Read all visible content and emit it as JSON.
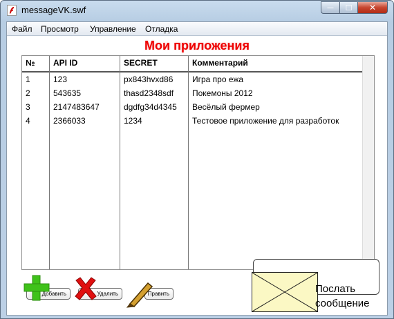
{
  "window": {
    "title": "messageVK.swf",
    "controls": {
      "minimize": "—",
      "maximize": "☐",
      "close": "✕"
    }
  },
  "menu": {
    "items": [
      "Файл",
      "Просмотр",
      "Управление",
      "Отладка"
    ]
  },
  "heading": "Мои приложения",
  "table": {
    "columns": [
      "№",
      "API ID",
      "SECRET",
      "Комментарий"
    ],
    "rows": [
      [
        "1",
        "123",
        "px843hvxd86",
        "Игра про ежа"
      ],
      [
        "2",
        "543635",
        "thasd2348sdf",
        "Покемоны 2012"
      ],
      [
        "3",
        "2147483647",
        "dgdfg34d4345",
        "Весёлый фермер"
      ],
      [
        "4",
        "2366033",
        "1234",
        "Тестовое приложение для разработок"
      ]
    ]
  },
  "actions": {
    "add_label": "Добавить",
    "delete_label": "Удалить",
    "edit_label": "Править",
    "send_line1": "Послать",
    "send_line2": "сообщение"
  },
  "icons": {
    "add": "plus-icon",
    "delete": "x-cross-icon",
    "edit": "pencil-icon",
    "send": "envelope-icon"
  },
  "colors": {
    "heading": "#ee0000",
    "add_icon": "#3fc21a",
    "delete_icon": "#e01010",
    "envelope_fill": "#fbf8c4"
  }
}
